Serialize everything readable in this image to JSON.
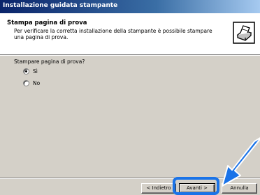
{
  "window": {
    "title": "Installazione guidata stampante"
  },
  "header": {
    "title": "Stampa pagina di prova",
    "subtitle": "Per verificare la corretta installazione della stampante è possibile stampare una pagina di prova.",
    "icon": "printer-icon"
  },
  "question": {
    "label": "Stampare pagina di prova?",
    "options": [
      {
        "label": "Sì",
        "checked": true
      },
      {
        "label": "No",
        "checked": false
      }
    ]
  },
  "buttons": {
    "back": "< Indietro",
    "next": "Avanti >",
    "cancel": "Annulla"
  },
  "annotation": {
    "highlight_color": "#1a73e8",
    "arrow_icon": "pointer-arrow-icon"
  }
}
